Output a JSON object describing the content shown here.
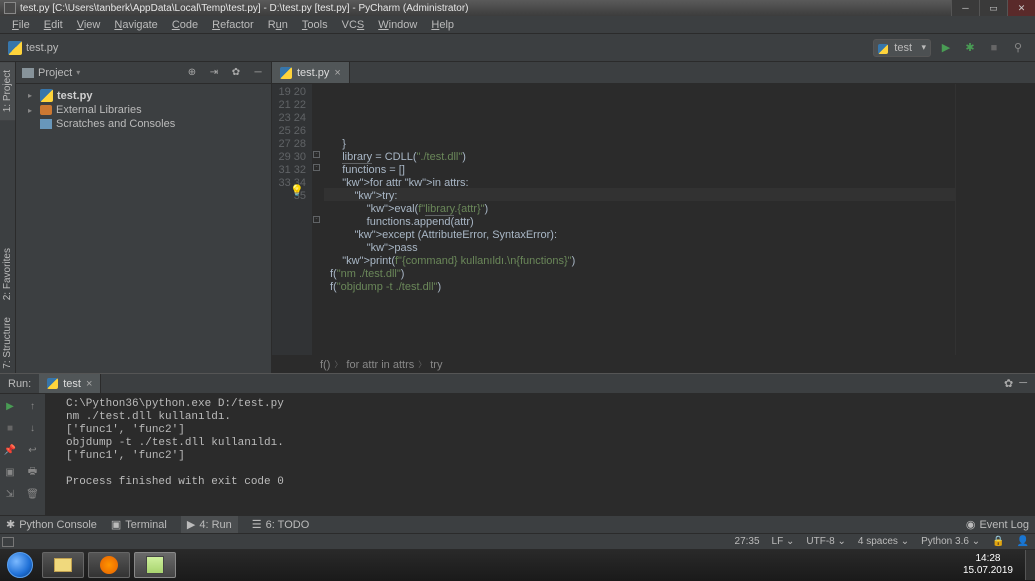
{
  "titlebar": {
    "text": "test.py [C:\\Users\\tanberk\\AppData\\Local\\Temp\\test.py] - D:\\test.py [test.py] - PyCharm (Administrator)"
  },
  "menu": {
    "items": [
      "File",
      "Edit",
      "View",
      "Navigate",
      "Code",
      "Refactor",
      "Run",
      "Tools",
      "VCS",
      "Window",
      "Help"
    ]
  },
  "crumb": {
    "file": "test.py"
  },
  "runcfg": {
    "label": "test"
  },
  "project": {
    "header": "Project",
    "items": [
      {
        "label": "test.py",
        "kind": "py",
        "bold": true,
        "arrow": "▸",
        "level": 0
      },
      {
        "label": "External Libraries",
        "kind": "lib",
        "bold": false,
        "arrow": "▸",
        "level": 0
      },
      {
        "label": "Scratches and Consoles",
        "kind": "scratch",
        "bold": false,
        "arrow": "",
        "level": 0
      }
    ]
  },
  "sidetabs": {
    "project": "1: Project",
    "favorites": "2: Favorites",
    "structure": "7: Structure"
  },
  "tab": {
    "label": "test.py"
  },
  "gutter": {
    "start": 19,
    "end": 35
  },
  "code": {
    "lines": [
      "    }",
      "    library = CDLL(\"./test.dll\")",
      "",
      "    functions = []",
      "",
      "    for attr in attrs:",
      "        try:",
      "            eval(f\"library.{attr}\")",
      "            functions.append(attr)",
      "        except (AttributeError, SyntaxError):",
      "            pass",
      "",
      "    print(f\"{command} kullanıldı.\\n{functions}\")",
      "",
      "",
      "f(\"nm ./test.dll\")",
      "f(\"objdump -t ./test.dll\")"
    ],
    "highlight_row": 8
  },
  "breadcrumb": {
    "items": [
      "f()",
      "for attr in attrs",
      "try"
    ]
  },
  "run": {
    "label": "Run:",
    "tab": "test",
    "console": "C:\\Python36\\python.exe D:/test.py\nnm ./test.dll kullanıldı.\n['func1', 'func2']\nobjdump -t ./test.dll kullanıldı.\n['func1', 'func2']\n\nProcess finished with exit code 0"
  },
  "bottombar": {
    "python": "Python Console",
    "terminal": "Terminal",
    "run": "4: Run",
    "todo": "6: TODO",
    "eventlog": "Event Log"
  },
  "status": {
    "pos": "27:35",
    "le": "LF",
    "enc": "UTF-8",
    "indent": "4 spaces",
    "interp": "Python 3.6"
  },
  "clock": {
    "time": "14:28",
    "date": "15.07.2019"
  }
}
